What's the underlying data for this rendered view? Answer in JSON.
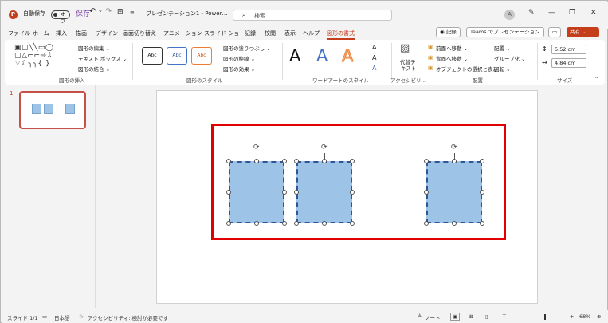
{
  "titlebar": {
    "autosave_label": "自動保存",
    "autosave_state": "オフ",
    "qat_save": "保存",
    "qat_undo": "↶",
    "qat_undo_caret": "⌄",
    "qat_redo": "↷",
    "qat_customize": "⊞",
    "qat_more": "≡",
    "doc_title": "プレゼンテーション1 - Power…",
    "search_placeholder": "検索",
    "avatar": "A",
    "pen": "✎",
    "minimize": "—",
    "restore": "❐",
    "close": "✕"
  },
  "menu": {
    "items": [
      "ファイル",
      "ホーム",
      "挿入",
      "描画",
      "デザイン",
      "画面切り替え",
      "アニメーション",
      "スライド ショー",
      "記録",
      "校閲",
      "表示",
      "ヘルプ",
      "図形の書式"
    ],
    "active_index": 12,
    "record_button": "◉ 記録",
    "teams_button": "Teams でプレゼンテーション",
    "comment_button": "▭",
    "share_button": "共有 ⌄"
  },
  "ribbon": {
    "insert_shapes": {
      "glyphs_row1": "▣▢╲╲▭◯",
      "glyphs_row2": "▢△⌐⌐⇨⇩",
      "glyphs_row3": "⌔☾╮╮{ }",
      "edit_shape": "図形の編集 ⌄",
      "text_box": "テキスト ボックス ⌄",
      "merge_shapes": "図形の結合 ⌄",
      "label": "図形の挿入"
    },
    "shape_styles": {
      "preset_1": "Abc",
      "preset_2": "Abc",
      "preset_3": "Abc",
      "fill": "図形の塗りつぶし ⌄",
      "outline": "図形の枠線 ⌄",
      "effects": "図形の効果 ⌄",
      "label": "図形のスタイル"
    },
    "wordart": {
      "sample_1": "A",
      "sample_2": "A",
      "sample_3": "A",
      "label": "ワードアートのスタイル"
    },
    "accessibility": {
      "alt_text_line1": "代替テ",
      "alt_text_line2": "キスト",
      "label": "アクセシビリ…"
    },
    "arrange": {
      "bring_forward": "前面へ移動 ⌄",
      "send_backward": "背面へ移動 ⌄",
      "selection_pane": "オブジェクトの選択と表示",
      "align": "配置 ⌄",
      "group": "グループ化 ⌄",
      "rotate": "回転 ⌄",
      "label": "配置"
    },
    "size": {
      "height": "5.52 cm",
      "width": "4.84 cm",
      "label": "サイズ"
    }
  },
  "thumbnail": {
    "number": "1"
  },
  "statusbar": {
    "slide": "スライド 1/1",
    "language": "日本語",
    "accessibility": "アクセシビリティ: 検討が必要です",
    "notes": "ノート",
    "zoom": "68%",
    "zoom_minus": "—",
    "zoom_plus": "+"
  },
  "colors": {
    "accent": "#c43e1c",
    "shape_fill": "#9dc3e6",
    "shape_border": "#2f5597",
    "highlight_frame": "#e00000"
  }
}
